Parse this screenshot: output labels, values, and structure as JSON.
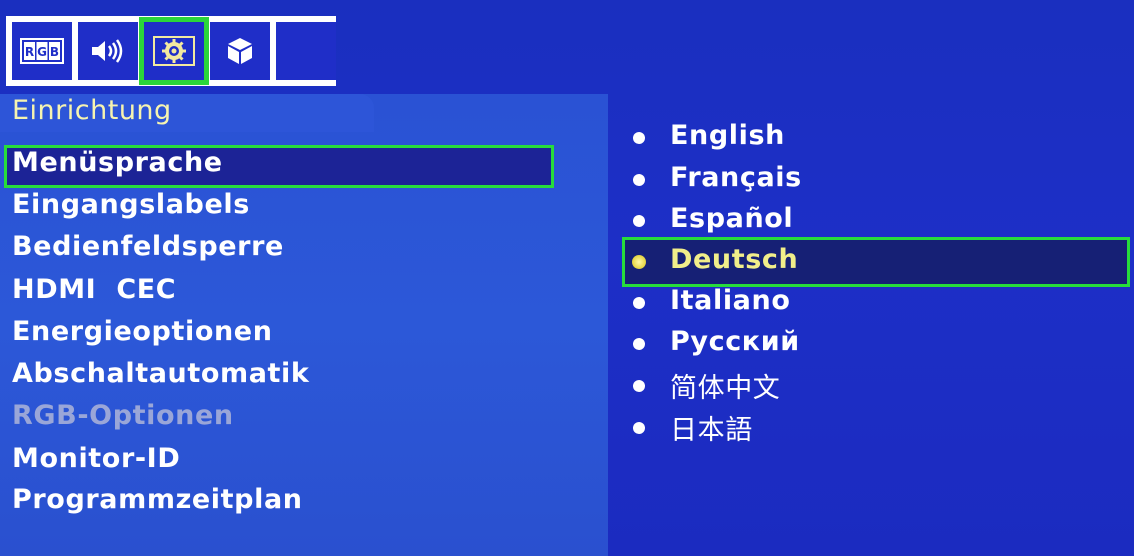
{
  "toolbar": {
    "buttons": [
      {
        "name": "rgb",
        "icon": "rgb-icon",
        "label": "RGB",
        "selected": false
      },
      {
        "name": "audio",
        "icon": "speaker-icon",
        "selected": false
      },
      {
        "name": "setup",
        "icon": "gear-icon",
        "selected": true
      },
      {
        "name": "input",
        "icon": "cube-icon",
        "selected": false
      },
      {
        "name": "empty",
        "icon": "",
        "selected": false
      }
    ]
  },
  "section": {
    "title": "Einrichtung"
  },
  "menu": {
    "items": [
      {
        "label": "Menüsprache",
        "selected": true,
        "enabled": true
      },
      {
        "label": "Eingangslabels",
        "selected": false,
        "enabled": true
      },
      {
        "label": "Bedienfeldsperre",
        "selected": false,
        "enabled": true
      },
      {
        "label": "HDMI  CEC",
        "selected": false,
        "enabled": true
      },
      {
        "label": "Energieoptionen",
        "selected": false,
        "enabled": true
      },
      {
        "label": "Abschaltautomatik",
        "selected": false,
        "enabled": true
      },
      {
        "label": "RGB-Optionen",
        "selected": false,
        "enabled": false
      },
      {
        "label": "Monitor-ID",
        "selected": false,
        "enabled": true
      },
      {
        "label": "Programmzeitplan",
        "selected": false,
        "enabled": true
      }
    ]
  },
  "languages": {
    "options": [
      {
        "label": "English",
        "selected": false
      },
      {
        "label": "Français",
        "selected": false
      },
      {
        "label": "Español",
        "selected": false
      },
      {
        "label": "Deutsch",
        "selected": true
      },
      {
        "label": "Italiano",
        "selected": false
      },
      {
        "label": "Русский",
        "selected": false
      },
      {
        "label": "简体中文",
        "selected": false
      },
      {
        "label": "日本語",
        "selected": false
      }
    ]
  },
  "colors": {
    "background": "#1d2fc7",
    "highlight_border": "#27dd3b",
    "selected_text": "#f1ee8a",
    "disabled_text": "#9aa6d8"
  }
}
